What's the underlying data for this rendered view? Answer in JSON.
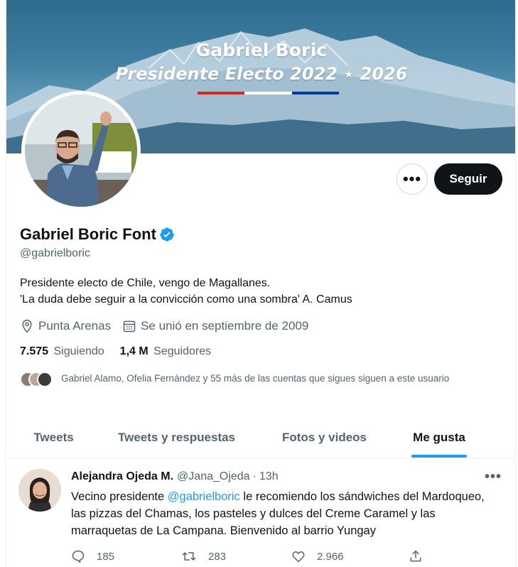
{
  "banner": {
    "title": "Gabriel Boric",
    "subtitle": "Presidente Electo 2022 ⋆ 2026",
    "flag_colors": [
      "#d52b1e",
      "#ffffff",
      "#0039a6"
    ]
  },
  "profile": {
    "display_name": "Gabriel Boric Font",
    "handle": "@gabrielboric",
    "verified": true,
    "bio_line1": "Presidente electo de Chile, vengo de Magallanes.",
    "bio_line2": "'La duda debe seguir a la convicción como una sombra' A. Camus",
    "location": "Punta Arenas",
    "joined": "Se unió en septiembre de 2009",
    "following_count": "7.575",
    "following_label": "Siguiendo",
    "followers_count": "1,4 M",
    "followers_label": "Seguidores",
    "known_followers_text": "Gabriel Alamo, Ofelia Fernández y 55 más de las cuentas que sigues siguen a este usuario"
  },
  "actions": {
    "more_label": "•••",
    "follow_label": "Seguir"
  },
  "tabs": [
    {
      "label": "Tweets",
      "active": false
    },
    {
      "label": "Tweets y respuestas",
      "active": false
    },
    {
      "label": "Fotos y videos",
      "active": false
    },
    {
      "label": "Me gusta",
      "active": true
    }
  ],
  "tweet": {
    "author_name": "Alejandra Ojeda M.",
    "author_handle": "@Jana_Ojeda",
    "separator": "·",
    "time": "13h",
    "more_label": "•••",
    "text_before": "Vecino presidente ",
    "mention": "@gabrielboric",
    "text_after": " le recomiendo los sándwiches del Mardoqueo, las pizzas del Chamas, los pasteles y dulces del Creme Caramel y las marraquetas de La Campana. Bienvenido al barrio Yungay",
    "replies": "185",
    "retweets": "283",
    "likes": "2.966"
  },
  "colors": {
    "accent": "#1d9bf0",
    "text_primary": "#0f1419",
    "text_secondary": "#536471",
    "follow_button_bg": "#0f1419"
  },
  "icons": {
    "verified": "verified-badge-icon",
    "location": "location-pin-icon",
    "calendar": "calendar-icon",
    "reply": "reply-icon",
    "retweet": "retweet-icon",
    "like": "heart-icon",
    "share": "share-icon"
  }
}
